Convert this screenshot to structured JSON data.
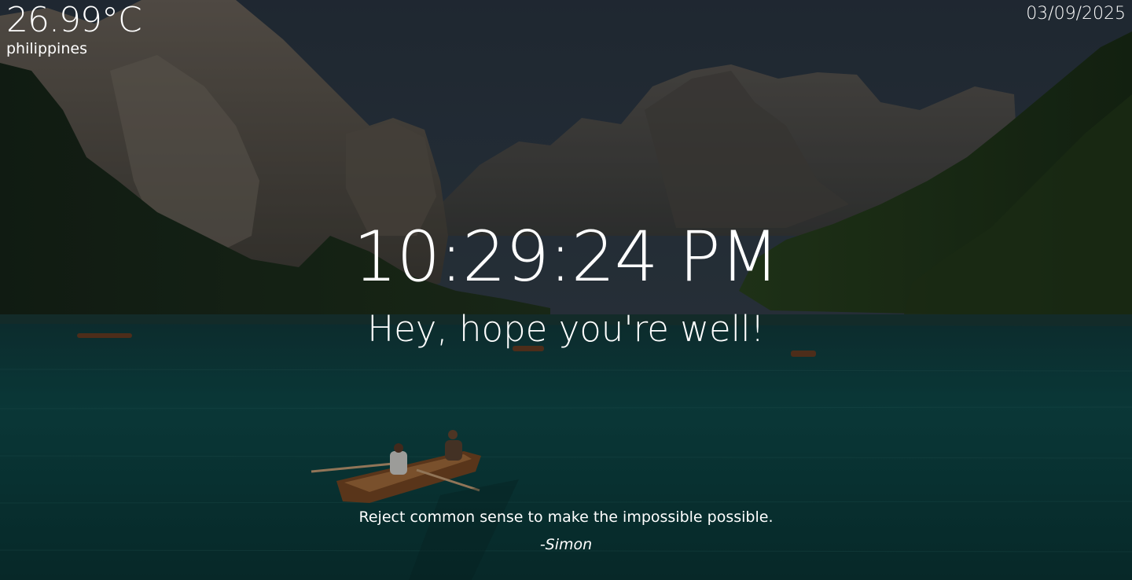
{
  "weather": {
    "temperature": "26.99°C",
    "location": "philippines"
  },
  "date": "03/09/2025",
  "clock": "10:29:24 PM",
  "greeting": "Hey, hope you're well!",
  "quote": {
    "text": "Reject common sense to make the impossible possible.",
    "author": "-Simon"
  },
  "background": {
    "scene": "mountain lake with rowing boat",
    "colors": {
      "sky": "#2f3c48",
      "mountain": "#5a544e",
      "forest": "#1f3222",
      "water": "#0f4a4a"
    }
  }
}
